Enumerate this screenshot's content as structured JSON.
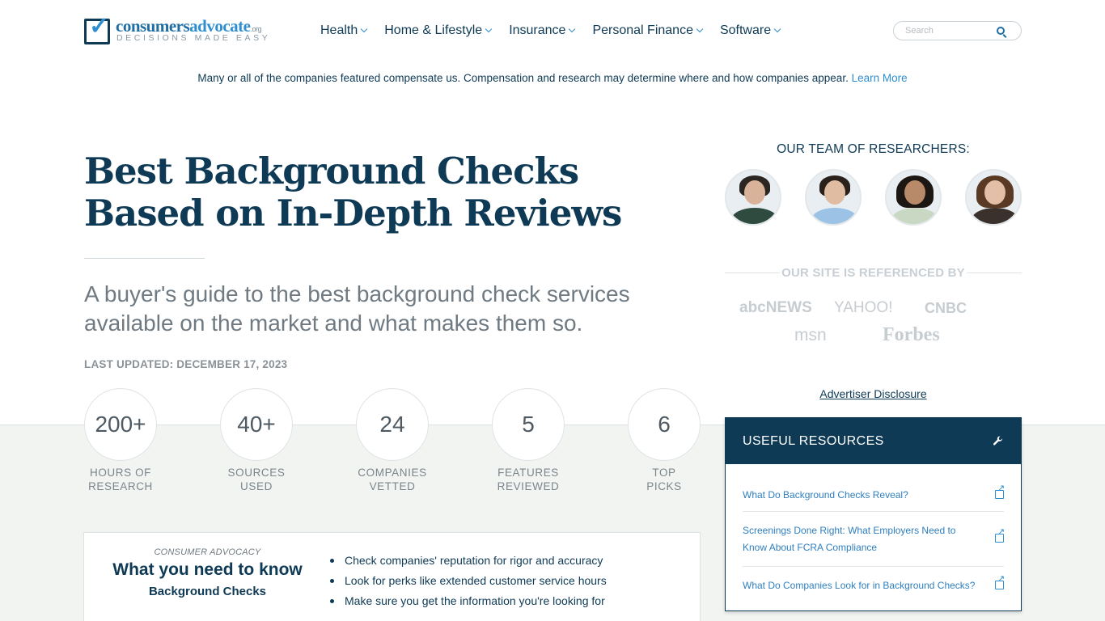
{
  "header": {
    "logo": {
      "name_part1": "consumers",
      "name_part2": "advocate",
      "suffix": ".org",
      "tagline": "DECISIONS MADE EASY"
    },
    "nav": [
      {
        "label": "Health"
      },
      {
        "label": "Home & Lifestyle"
      },
      {
        "label": "Insurance"
      },
      {
        "label": "Personal Finance"
      },
      {
        "label": "Software"
      }
    ],
    "search": {
      "placeholder": "Search"
    }
  },
  "disclosure": {
    "text": "Many or all of the companies featured compensate us. Compensation and research may determine where and how companies appear.",
    "link": "Learn More"
  },
  "hero": {
    "title_line1": "Best Background Checks",
    "title_line2": "Based on In-Depth Reviews",
    "subtitle": "A buyer's guide to the best background check services available on the market and what makes them so.",
    "updated": "LAST UPDATED: DECEMBER 17, 2023"
  },
  "stats": [
    {
      "value": "200+",
      "label": "HOURS OF\nRESEARCH"
    },
    {
      "value": "40+",
      "label": "SOURCES\nUSED"
    },
    {
      "value": "24",
      "label": "COMPANIES\nVETTED"
    },
    {
      "value": "5",
      "label": "FEATURES\nREVIEWED"
    },
    {
      "value": "6",
      "label": "TOP\nPICKS"
    }
  ],
  "know": {
    "kicker": "CONSUMER ADVOCACY",
    "title": "What you need to know",
    "subtitle": "Background Checks",
    "items": [
      "Check companies' reputation for rigor and accuracy",
      "Look for perks like extended customer service hours",
      "Make sure you get the information you're looking for"
    ]
  },
  "sidebar": {
    "team_title": "OUR TEAM OF RESEARCHERS:",
    "referenced_title": "OUR SITE IS REFERENCED BY",
    "press": [
      "abcNEWS",
      "YAHOO!",
      "CNBC",
      "msn",
      "Forbes"
    ],
    "advertiser_link": "Advertiser Disclosure",
    "resources": {
      "title": "USEFUL RESOURCES",
      "items": [
        "What Do Background Checks Reveal?",
        "Screenings Done Right: What Employers Need to Know About FCRA Compliance",
        "What Do Companies Look for in Background Checks?"
      ]
    }
  }
}
